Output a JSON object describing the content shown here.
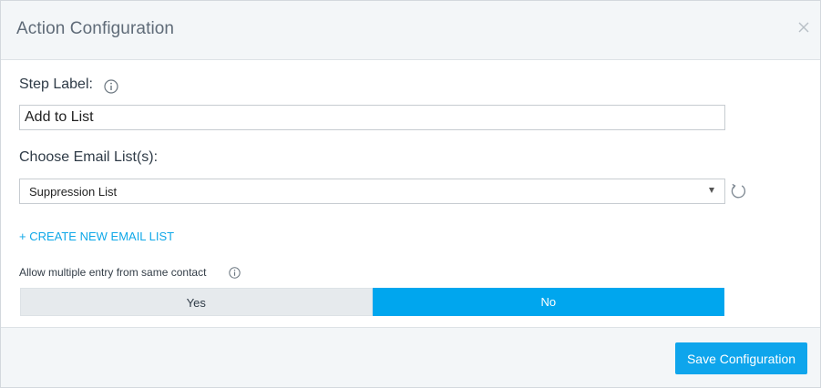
{
  "header": {
    "title": "Action Configuration",
    "close_glyph": "×"
  },
  "step_label": {
    "label": "Step Label:",
    "value": "Add to List"
  },
  "email_list": {
    "label": "Choose Email List(s):",
    "selected": "Suppression List"
  },
  "create_link": "+ CREATE NEW EMAIL LIST",
  "multiple_entry": {
    "label": "Allow multiple entry from same contact",
    "options": [
      "Yes",
      "No"
    ],
    "selected": "No"
  },
  "footer": {
    "save_label": "Save Configuration"
  },
  "colors": {
    "accent": "#00a6ee",
    "header_bg": "#f3f6f8",
    "title_text": "#5f6b78"
  },
  "icons": {
    "close": "close-icon",
    "info": "info-icon",
    "caret": "chevron-down-icon",
    "refresh": "refresh-icon"
  }
}
